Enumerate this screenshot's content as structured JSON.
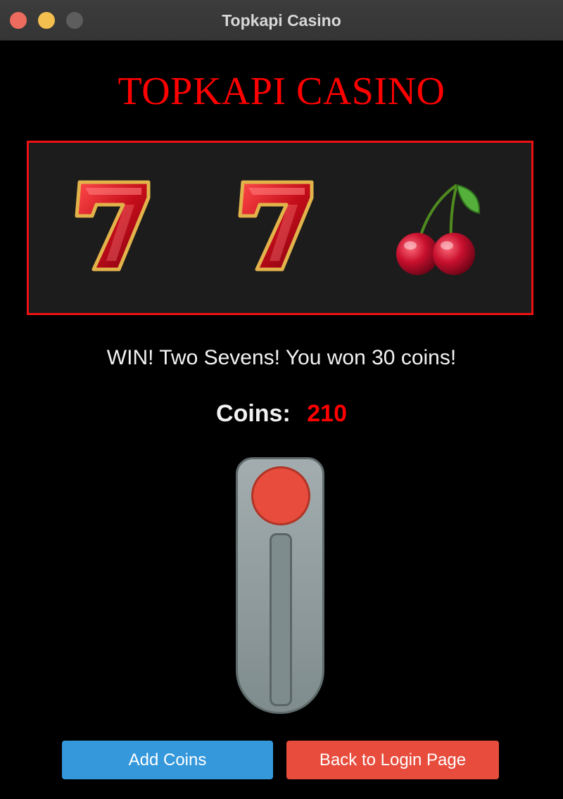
{
  "window": {
    "title": "Topkapi Casino"
  },
  "header": {
    "title": "TOPKAPI CASINO"
  },
  "reels": {
    "symbols": [
      "seven-icon",
      "seven-icon",
      "cherry-icon"
    ],
    "border_color": "#ee1111"
  },
  "result": {
    "message": "WIN! Two Sevens! You won 30 coins!"
  },
  "coins": {
    "label": "Coins:",
    "value": "210"
  },
  "buttons": {
    "add_coins": "Add Coins",
    "back_to_login": "Back to Login Page"
  },
  "colors": {
    "accent_red": "#ff0000",
    "add_button": "#3498db",
    "back_button": "#e74c3c",
    "lever_knob": "#e74c3c"
  }
}
